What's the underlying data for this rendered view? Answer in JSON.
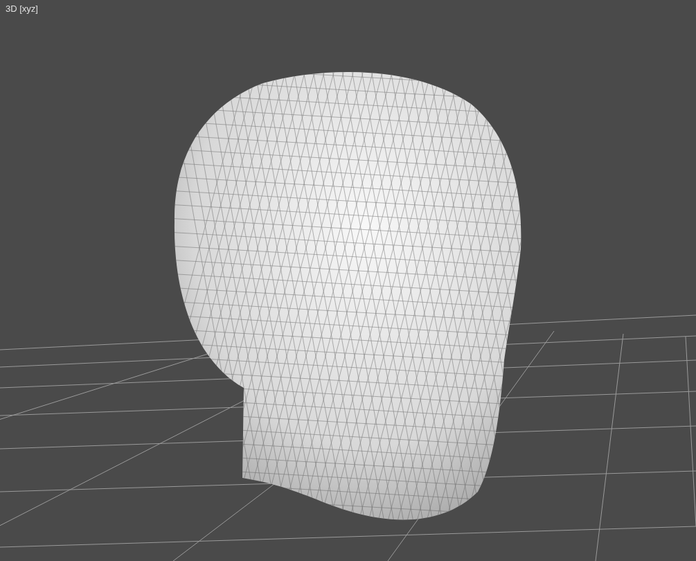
{
  "viewport": {
    "label": "3D [xyz]"
  }
}
